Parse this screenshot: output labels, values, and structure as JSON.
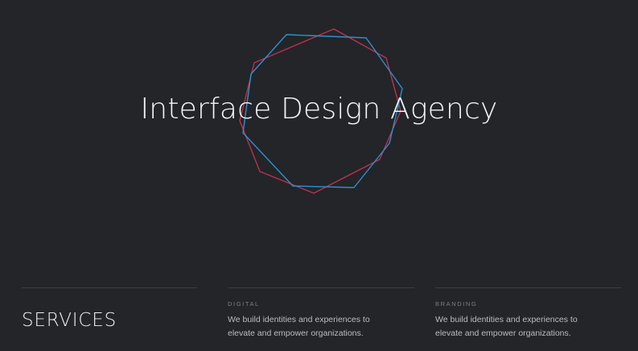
{
  "hero": {
    "title": "Interface Design Agency"
  },
  "colors": {
    "background": "#232528",
    "accent_red": "#c0304e",
    "accent_blue": "#2e8fd0"
  },
  "services": {
    "heading": "SERVICES",
    "items": [
      {
        "label": "DIGITAL",
        "description": "We build identities and experiences to elevate and empower organizations."
      },
      {
        "label": "BRANDING",
        "description": "We build identities and experiences to elevate and empower organizations."
      }
    ]
  }
}
